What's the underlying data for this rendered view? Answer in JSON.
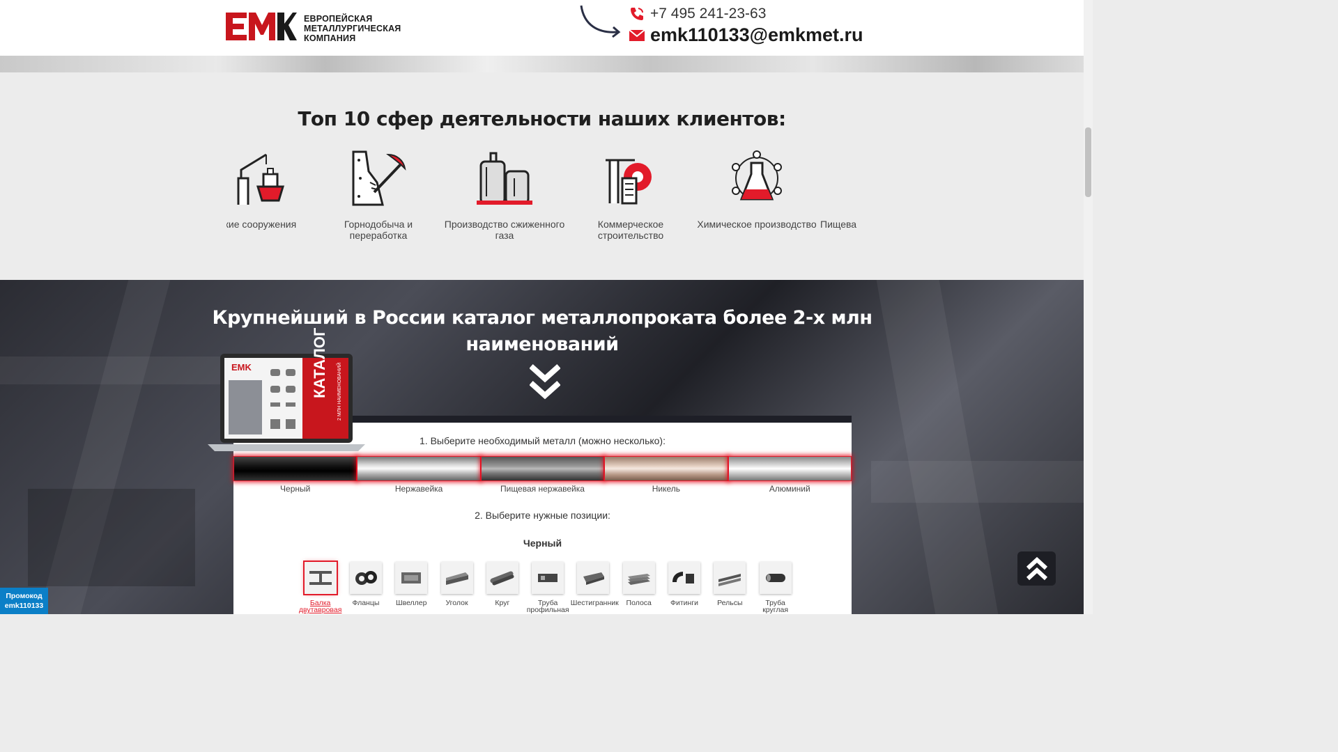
{
  "header": {
    "logo_mark": "EMK",
    "logo_text": [
      "ЕВРОПЕЙСКАЯ",
      "МЕТАЛЛУРГИЧЕСКАЯ",
      "КОМПАНИЯ"
    ],
    "phone": "+7 495 241-23-63",
    "email": "emk110133@emkmet.ru"
  },
  "spheres": {
    "title": "Топ 10 сфер деятельности наших клиентов:",
    "items": [
      {
        "label": "ские сооружения",
        "icon": "ship-crane-icon"
      },
      {
        "label": "Горнодобыча и переработка",
        "icon": "mining-pickaxe-icon"
      },
      {
        "label": "Производство сжиженного газа",
        "icon": "gas-tanks-icon"
      },
      {
        "label": "Коммерческое строительство",
        "icon": "construction-crane-icon"
      },
      {
        "label": "Химическое производство",
        "icon": "chemical-flask-icon"
      },
      {
        "label": "Пищева",
        "icon": "food-production-icon"
      }
    ]
  },
  "catalog": {
    "title_line1": "Крупнейший в России каталог металлопроката более 2-х млн",
    "title_line2": "наименований",
    "laptop_logo": "EMK",
    "laptop_caption": "КАТАЛОГ",
    "laptop_sub": "2 МЛН НАИМЕНОВАНИЙ",
    "step1": "1. Выберите необходимый металл (можно несколько):",
    "step2": "2. Выберите нужные позиции:",
    "metals": [
      {
        "label": "Черный"
      },
      {
        "label": "Нержавейка"
      },
      {
        "label": "Пищевая нержавейка"
      },
      {
        "label": "Никель"
      },
      {
        "label": "Алюминий"
      }
    ],
    "selected_metal": "Черный",
    "products": [
      {
        "label": "Балка двутавровая",
        "active": true
      },
      {
        "label": "Фланцы"
      },
      {
        "label": "Швеллер"
      },
      {
        "label": "Уголок"
      },
      {
        "label": "Круг"
      },
      {
        "label": "Труба профильная"
      },
      {
        "label": "Шестигранник"
      },
      {
        "label": "Полоса"
      },
      {
        "label": "Фитинги"
      },
      {
        "label": "Рельсы"
      },
      {
        "label": "Труба круглая"
      }
    ]
  },
  "promo": {
    "line1": "Промокод",
    "line2": "emk110133"
  },
  "colors": {
    "accent": "#e21b2a",
    "promo": "#0b7fc7",
    "dark": "#1d1e24"
  }
}
